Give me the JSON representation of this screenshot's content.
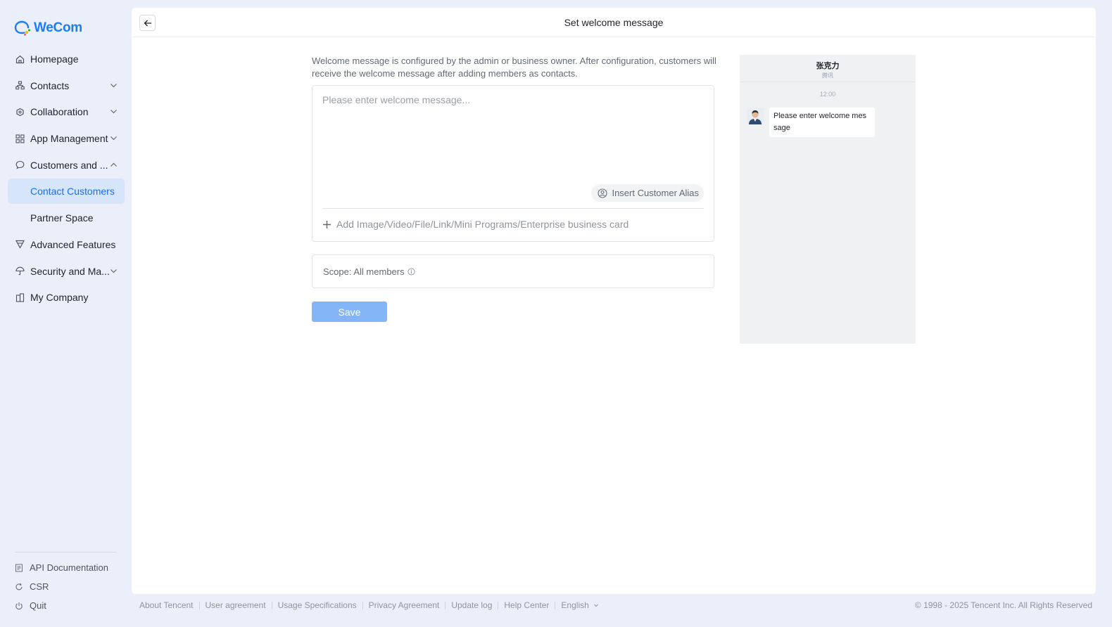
{
  "brand": {
    "name": "WeCom",
    "accent": "#1c7ef6"
  },
  "sidebar": {
    "items": [
      {
        "label": "Homepage",
        "icon": "home-icon",
        "expandable": false
      },
      {
        "label": "Contacts",
        "icon": "org-chart-icon",
        "expandable": true,
        "expanded": false
      },
      {
        "label": "Collaboration",
        "icon": "collaboration-icon",
        "expandable": true,
        "expanded": false
      },
      {
        "label": "App Management",
        "icon": "grid-icon",
        "expandable": true,
        "expanded": false
      },
      {
        "label": "Customers and ...",
        "icon": "chat-bubble-icon",
        "expandable": true,
        "expanded": true
      },
      {
        "label": "Contact Customers",
        "sub": true,
        "active": true
      },
      {
        "label": "Partner Space",
        "sub": true
      },
      {
        "label": "Advanced Features",
        "icon": "filter-icon",
        "expandable": false
      },
      {
        "label": "Security and Ma...",
        "icon": "umbrella-icon",
        "expandable": true,
        "expanded": false
      },
      {
        "label": "My Company",
        "icon": "building-icon",
        "expandable": false
      }
    ],
    "bottom_links": [
      {
        "label": "API Documentation",
        "icon": "document-icon"
      },
      {
        "label": "CSR",
        "icon": "refresh-icon"
      },
      {
        "label": "Quit",
        "icon": "power-icon"
      }
    ]
  },
  "page": {
    "title": "Set welcome message",
    "description": "Welcome message is configured by the admin or business owner. After configuration, customers will receive the welcome message after adding members as contacts.",
    "editor": {
      "placeholder": "Please enter welcome message...",
      "value": "",
      "insert_alias_label": "Insert Customer Alias",
      "add_attachment_label": "Add Image/Video/File/Link/Mini Programs/Enterprise business card"
    },
    "scope_label": "Scope: All members",
    "save_label": "Save"
  },
  "preview": {
    "name": "张克力",
    "org": "腾讯",
    "time": "12:00",
    "message": "Please enter welcome mes sage"
  },
  "footer": {
    "links": [
      "About Tencent",
      "User agreement",
      "Usage Specifications",
      "Privacy Agreement",
      "Update log",
      "Help Center",
      "English"
    ],
    "copyright": "© 1998 - 2025 Tencent Inc. All Rights Reserved"
  }
}
